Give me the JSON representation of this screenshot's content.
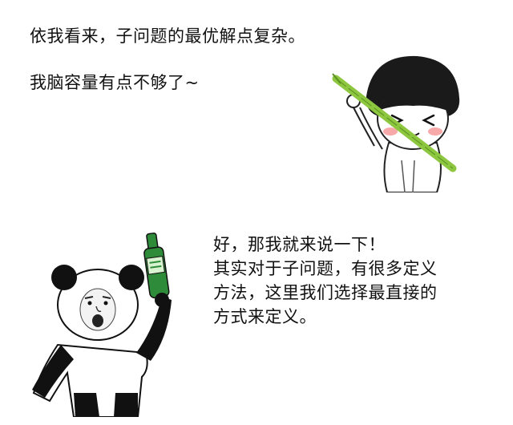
{
  "dialogue": {
    "line1": "依我看来，子问题的最优解点复杂。",
    "line2": "我脑容量有点不够了~",
    "paragraph": [
      "好，那我就来说一下！",
      "其实对于子问题，有很多定义",
      "方法，这里我们选择最直接的",
      "方式来定义。"
    ]
  },
  "stickers": {
    "top": {
      "icon": "girl-with-bamboo-sticker"
    },
    "bottom": {
      "icon": "panda-with-bottle-sticker"
    }
  },
  "colors": {
    "text": "#111111",
    "bamboo": "#8dc63f",
    "bottle": "#2e8b3a",
    "blush": "#f7a8a8"
  }
}
